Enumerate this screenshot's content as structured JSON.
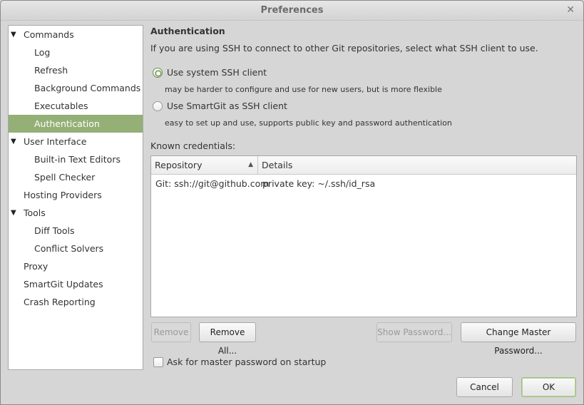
{
  "window": {
    "title": "Preferences",
    "close_icon": "close-icon"
  },
  "sidebar": {
    "items": [
      {
        "label": "Commands",
        "level": 0,
        "expanded": true
      },
      {
        "label": "Log",
        "level": 1
      },
      {
        "label": "Refresh",
        "level": 1
      },
      {
        "label": "Background Commands",
        "level": 1
      },
      {
        "label": "Executables",
        "level": 1
      },
      {
        "label": "Authentication",
        "level": 1,
        "selected": true
      },
      {
        "label": "User Interface",
        "level": 0,
        "expanded": true
      },
      {
        "label": "Built-in Text Editors",
        "level": 1
      },
      {
        "label": "Spell Checker",
        "level": 1
      },
      {
        "label": "Hosting Providers",
        "level": 0
      },
      {
        "label": "Tools",
        "level": 0,
        "expanded": true
      },
      {
        "label": "Diff Tools",
        "level": 1
      },
      {
        "label": "Conflict Solvers",
        "level": 1
      },
      {
        "label": "Proxy",
        "level": 0
      },
      {
        "label": "SmartGit Updates",
        "level": 0
      },
      {
        "label": "Crash Reporting",
        "level": 0
      }
    ],
    "selected_color": "#94b076"
  },
  "main": {
    "heading": "Authentication",
    "intro": "If you are using SSH to connect to other Git repositories, select what SSH client to use.",
    "options": [
      {
        "label": "Use system SSH client",
        "hint": "may be harder to configure and use for new users, but is more flexible",
        "checked": true
      },
      {
        "label": "Use SmartGit as SSH client",
        "hint": "easy to set up and use, supports public key and password authentication",
        "checked": false
      }
    ],
    "credentials_label": "Known credentials:",
    "table": {
      "columns": [
        "Repository",
        "Details"
      ],
      "sort_icon": "sort-ascending-icon",
      "rows": [
        [
          "Git: ssh://git@github.com",
          "private key: ~/.ssh/id_rsa"
        ]
      ]
    },
    "buttons": {
      "remove": "Remove",
      "remove_all": "Remove All...",
      "show_password": "Show Password...",
      "change_master": "Change Master Password..."
    },
    "ask_master": {
      "label": "Ask for master password on startup",
      "checked": false
    }
  },
  "footer": {
    "cancel": "Cancel",
    "ok": "OK"
  }
}
